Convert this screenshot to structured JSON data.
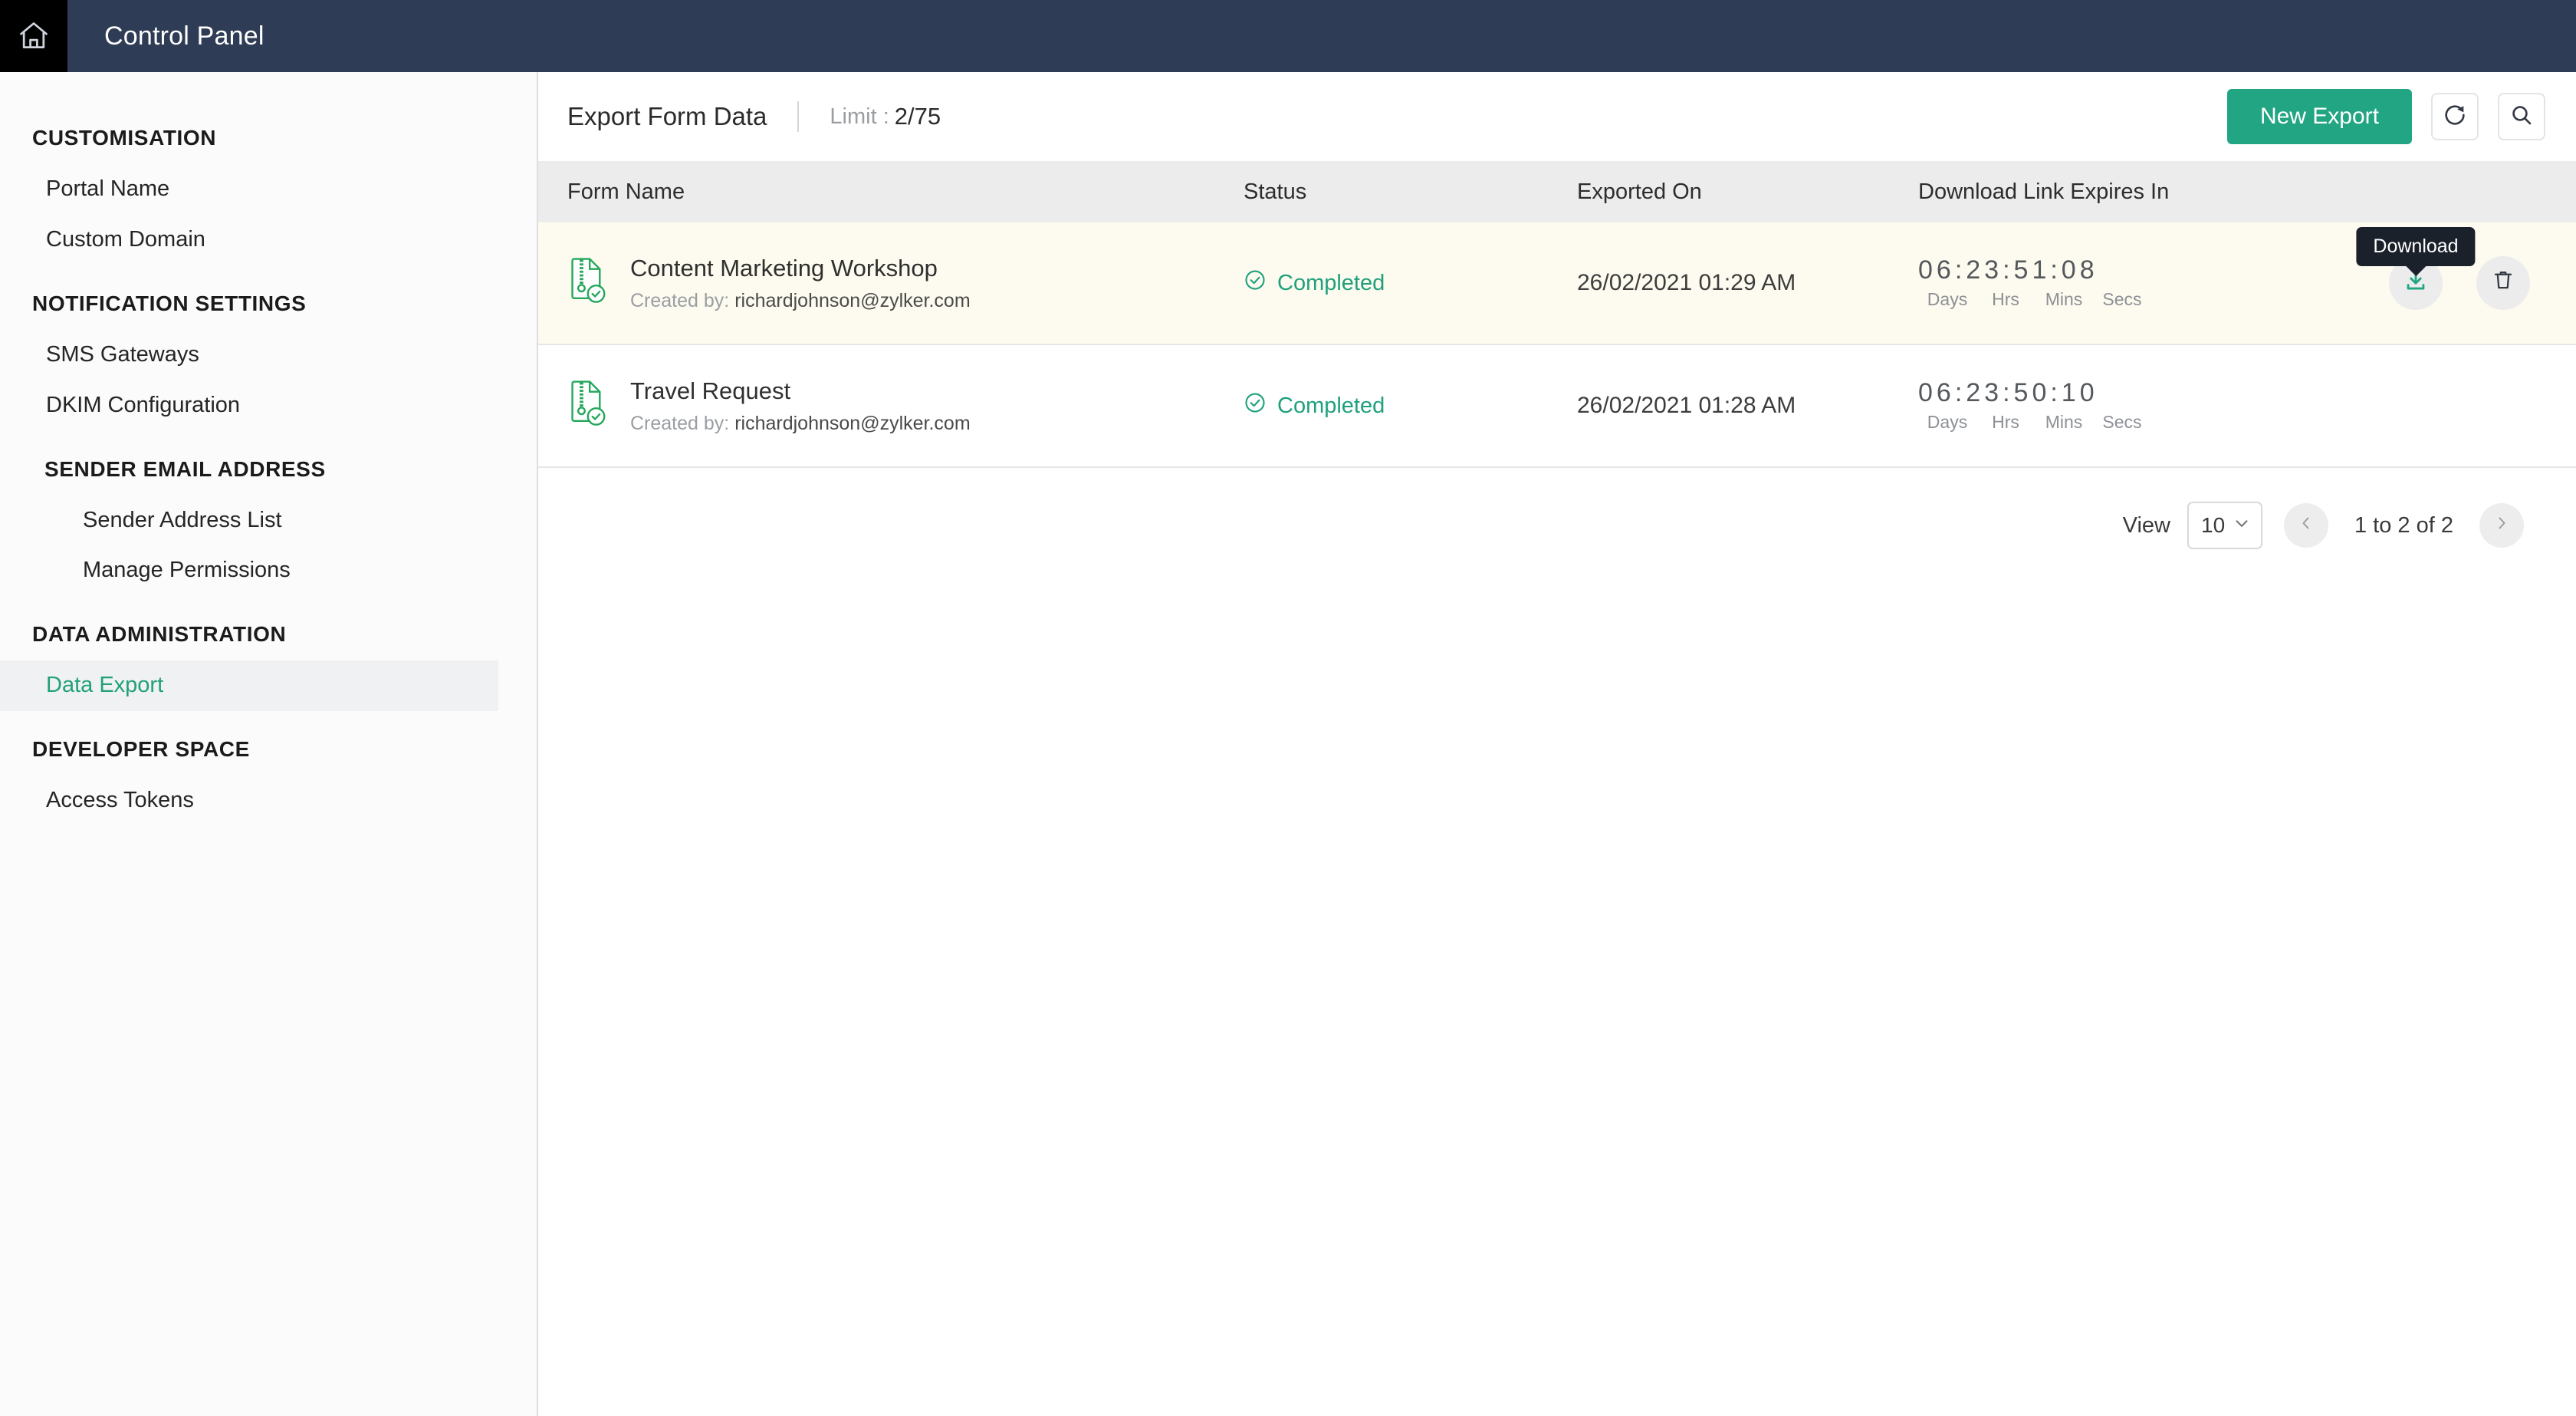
{
  "topbar": {
    "home_icon": "home-icon",
    "title": "Control Panel"
  },
  "sidebar": {
    "sections": [
      {
        "title": "CUSTOMISATION",
        "indent": false,
        "items": [
          {
            "label": "Portal Name",
            "active": false,
            "sub": false
          },
          {
            "label": "Custom Domain",
            "active": false,
            "sub": false
          }
        ]
      },
      {
        "title": "NOTIFICATION SETTINGS",
        "indent": false,
        "items": [
          {
            "label": "SMS Gateways",
            "active": false,
            "sub": false
          },
          {
            "label": "DKIM Configuration",
            "active": false,
            "sub": false
          }
        ]
      },
      {
        "title": "SENDER EMAIL ADDRESS",
        "indent": true,
        "items": [
          {
            "label": "Sender Address List",
            "active": false,
            "sub": true
          },
          {
            "label": "Manage Permissions",
            "active": false,
            "sub": true
          }
        ]
      },
      {
        "title": "DATA ADMINISTRATION",
        "indent": false,
        "items": [
          {
            "label": "Data Export",
            "active": true,
            "sub": false
          }
        ]
      },
      {
        "title": "DEVELOPER SPACE",
        "indent": false,
        "items": [
          {
            "label": "Access Tokens",
            "active": false,
            "sub": false
          }
        ]
      }
    ]
  },
  "header": {
    "page_title": "Export Form Data",
    "limit_label": "Limit :",
    "limit_value": "2/75",
    "new_export_label": "New Export",
    "refresh_icon": "refresh-icon",
    "search_icon": "search-icon"
  },
  "table": {
    "columns": {
      "form_name": "Form Name",
      "status": "Status",
      "exported_on": "Exported On",
      "expires_in": "Download Link Expires In"
    },
    "expiry_units": [
      "Days",
      "Hrs",
      "Mins",
      "Secs"
    ],
    "rows": [
      {
        "form_name": "Content Marketing Workshop",
        "created_by_label": "Created by:",
        "created_by_email": "richardjohnson@zylker.com",
        "status": "Completed",
        "exported_on": "26/02/2021 01:29 AM",
        "expires_in": "06:23:51:08",
        "expires_digits": [
          "0",
          "6",
          "2",
          "3",
          "5",
          "1",
          "0",
          "8"
        ],
        "highlighted": true,
        "show_actions": true
      },
      {
        "form_name": "Travel Request",
        "created_by_label": "Created by:",
        "created_by_email": "richardjohnson@zylker.com",
        "status": "Completed",
        "exported_on": "26/02/2021 01:28 AM",
        "expires_in": "06:23:50:10",
        "expires_digits": [
          "0",
          "6",
          "2",
          "3",
          "5",
          "0",
          "1",
          "0"
        ],
        "highlighted": false,
        "show_actions": false
      }
    ],
    "actions": {
      "download_tooltip": "Download",
      "download_icon": "download-icon",
      "delete_icon": "trash-icon"
    }
  },
  "pagination": {
    "view_label": "View",
    "page_size": "10",
    "range_text": "1 to 2 of 2",
    "prev_icon": "chevron-left-icon",
    "next_icon": "chevron-right-icon"
  },
  "colors": {
    "topbar": "#2f3c56",
    "accent_green": "#22a582",
    "status_green": "#1fa07c",
    "row_highlight": "#fdfbef",
    "tooltip_bg": "#1a212b"
  }
}
